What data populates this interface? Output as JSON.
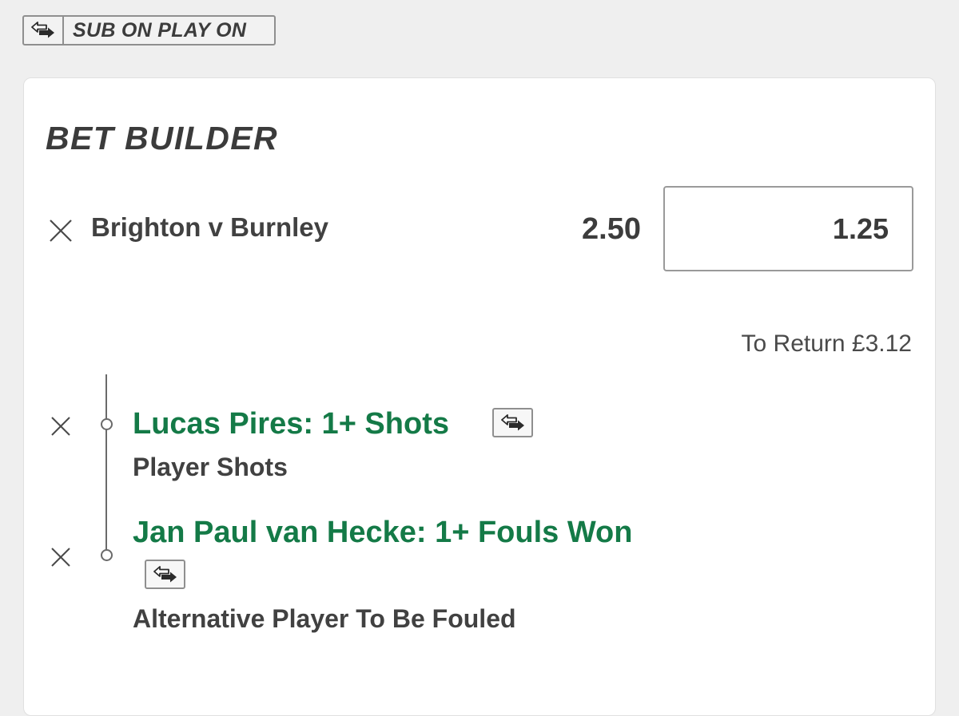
{
  "promo": {
    "label": "SUB ON PLAY ON",
    "icon": "substitution-arrows-icon"
  },
  "bet_builder": {
    "title": "BET BUILDER",
    "event": "Brighton v Burnley",
    "odds": "2.50",
    "stake_value": "1.25",
    "to_return": "To Return £3.12",
    "selections": [
      {
        "name": "Lucas Pires: 1+ Shots",
        "market": "Player Shots",
        "icon": "substitution-arrows-icon"
      },
      {
        "name": "Jan Paul van Hecke: 1+ Fouls Won",
        "market": "Alternative Player To Be Fouled",
        "icon": "substitution-arrows-icon"
      }
    ]
  },
  "colors": {
    "selection_green": "#147a47",
    "page_background": "#efefef",
    "card_background": "#ffffff"
  }
}
